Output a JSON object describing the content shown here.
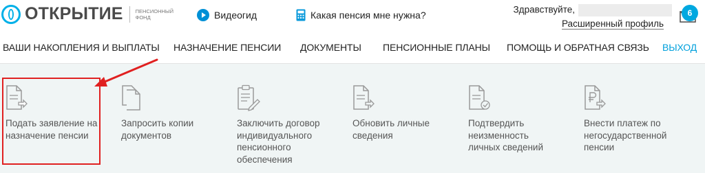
{
  "header": {
    "logo": {
      "name": "ОТКРЫТИЕ",
      "subtitle": "ПЕНСИОННЫЙ ФОНД"
    },
    "video_guide": "Видеогид",
    "pension_calc": "Какая пенсия мне нужна?",
    "greeting": "Здравствуйте,",
    "profile_link": "Расширенный профиль",
    "mail_count": "6"
  },
  "nav": {
    "items": [
      "ВАШИ НАКОПЛЕНИЯ И ВЫПЛАТЫ",
      "НАЗНАЧЕНИЕ ПЕНСИИ",
      "ДОКУМЕНТЫ",
      "ПЕНСИОННЫЕ ПЛАНЫ",
      "ПОМОЩЬ И ОБРАТНАЯ СВЯЗЬ"
    ],
    "exit": "ВЫХОД"
  },
  "actions": [
    {
      "label": "Подать заявление на назначение пенсии",
      "icon": "document-arrow-icon"
    },
    {
      "label": "Запросить копии документов",
      "icon": "copy-documents-icon"
    },
    {
      "label": "Заключить договор индивидуального пенсионного обеспечения",
      "icon": "clipboard-pen-icon"
    },
    {
      "label": "Обновить личные сведения",
      "icon": "document-arrow-icon"
    },
    {
      "label": "Подтвердить неизменность личных сведений",
      "icon": "document-check-icon"
    },
    {
      "label": "Внести платеж по негосударственной пенсии",
      "icon": "ruble-document-icon"
    }
  ],
  "colors": {
    "accent": "#00a0dc",
    "highlight": "#e02020",
    "panel": "#f0f5f5"
  }
}
